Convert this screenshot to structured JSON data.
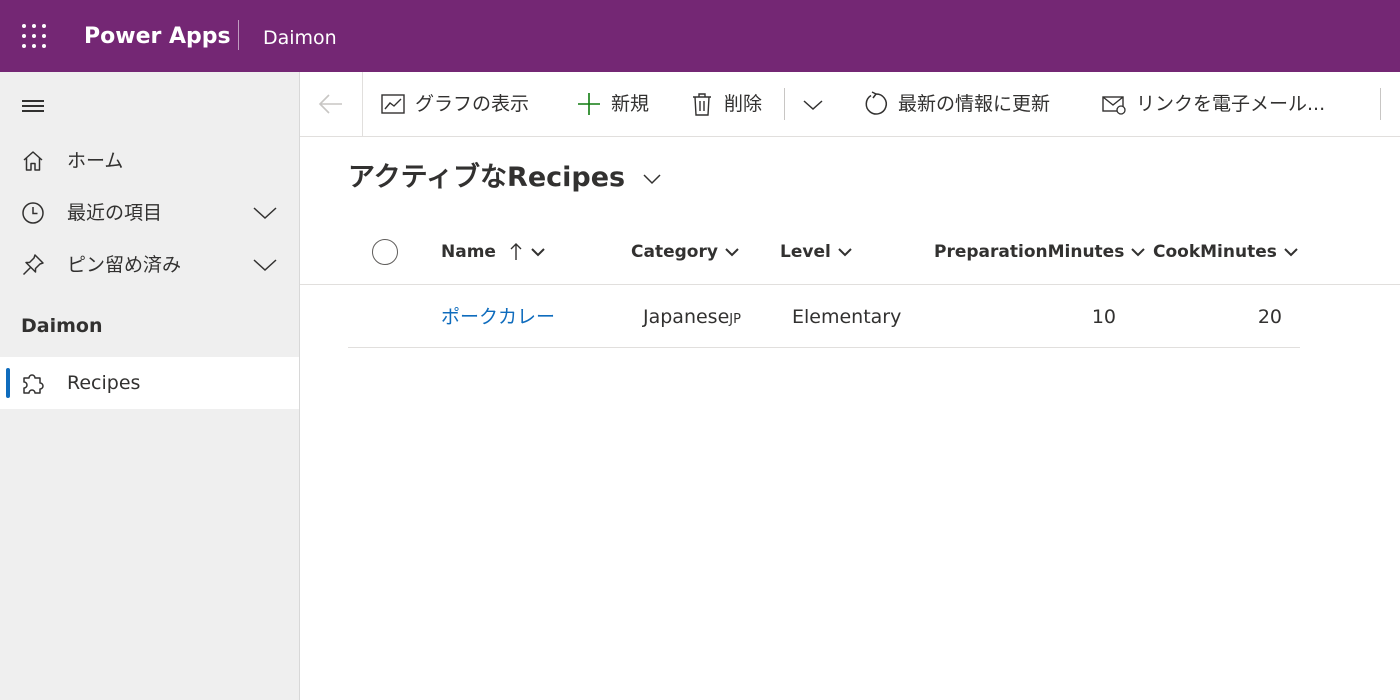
{
  "header": {
    "app_title": "Power Apps",
    "environment_name": "Daimon",
    "waffle_icon": "app-launcher-icon",
    "background_color": "#742774"
  },
  "sidebar": {
    "toggle_icon": "hamburger-icon",
    "items": [
      {
        "label": "ホーム",
        "icon": "home-icon"
      },
      {
        "label": "最近の項目",
        "icon": "clock-icon",
        "expandable": true
      },
      {
        "label": "ピン留め済み",
        "icon": "pin-icon",
        "expandable": true
      }
    ],
    "group_label": "Daimon",
    "group_items": [
      {
        "label": "Recipes",
        "icon": "puzzle-icon",
        "selected": true
      }
    ],
    "accent_color": "#0f6cbd"
  },
  "command_bar": {
    "back_icon": "back-arrow-icon",
    "show_chart_label": "グラフの表示",
    "new_label": "新規",
    "delete_label": "削除",
    "refresh_label": "最新の情報に更新",
    "email_link_label": "リンクを電子メール..."
  },
  "view": {
    "title": "アクティブなRecipes"
  },
  "grid": {
    "columns": [
      {
        "label": "Name",
        "sorted": "ascending"
      },
      {
        "label": "Category"
      },
      {
        "label": "Level"
      },
      {
        "label": "PreparationMinutes"
      },
      {
        "label": "CookMinutes"
      }
    ],
    "rows": [
      {
        "name": "ポークカレー",
        "category": "Japanese",
        "category_suffix": "JP",
        "level": "Elementary",
        "preparation_minutes": "10",
        "cook_minutes": "20"
      }
    ]
  }
}
